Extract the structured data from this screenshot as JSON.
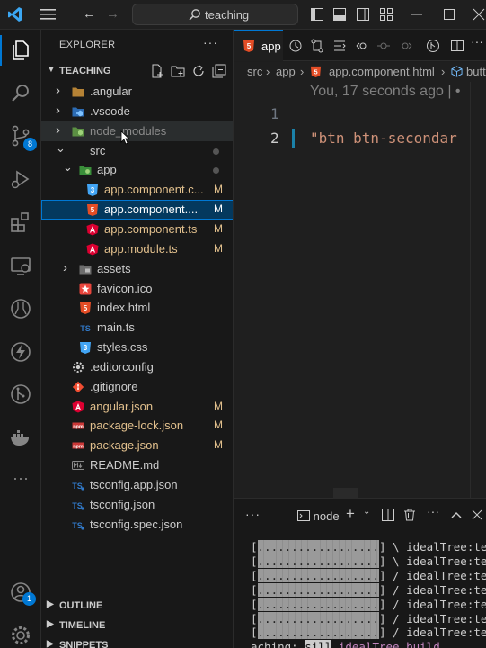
{
  "titlebar": {
    "search_text": "teaching"
  },
  "activity_bar": {
    "items": [
      {
        "name": "explorer-icon",
        "active": true
      },
      {
        "name": "search-icon"
      },
      {
        "name": "source-control-icon",
        "badge": "8"
      },
      {
        "name": "run-debug-icon"
      },
      {
        "name": "extensions-icon"
      },
      {
        "name": "remote-explorer-icon"
      },
      {
        "name": "testing-icon"
      },
      {
        "name": "lightning-icon"
      },
      {
        "name": "git-graph-icon"
      },
      {
        "name": "docker-icon"
      },
      {
        "name": "more-icon"
      }
    ],
    "accounts_badge": "1"
  },
  "explorer": {
    "title": "EXPLORER",
    "more": "···",
    "root": "TEACHING",
    "tree": [
      {
        "label": ".angular",
        "indent": 1,
        "type": "folder",
        "expanded": false,
        "icon": "folder-angular-icon"
      },
      {
        "label": ".vscode",
        "indent": 1,
        "type": "folder",
        "expanded": false,
        "icon": "folder-vscode-icon"
      },
      {
        "label": "node_modules",
        "indent": 1,
        "type": "folder",
        "expanded": false,
        "icon": "folder-node-icon",
        "dimmed": true,
        "hover": true
      },
      {
        "label": "src",
        "indent": 1,
        "type": "folder",
        "expanded": true,
        "modified_dot": true
      },
      {
        "label": "app",
        "indent": 2,
        "type": "folder",
        "expanded": true,
        "icon": "folder-app-icon",
        "modified_dot": true
      },
      {
        "label": "app.component.c...",
        "indent": 3,
        "icon": "css-file-icon",
        "status": "M"
      },
      {
        "label": "app.component....",
        "indent": 3,
        "icon": "html-file-icon",
        "status": "M",
        "selected": true
      },
      {
        "label": "app.component.ts",
        "indent": 3,
        "icon": "angular-file-icon",
        "status": "M"
      },
      {
        "label": "app.module.ts",
        "indent": 3,
        "icon": "angular-file-icon",
        "status": "M"
      },
      {
        "label": "assets",
        "indent": 2,
        "type": "folder",
        "expanded": false,
        "icon": "folder-assets-icon"
      },
      {
        "label": "favicon.ico",
        "indent": 2,
        "icon": "favicon-file-icon"
      },
      {
        "label": "index.html",
        "indent": 2,
        "icon": "html-file-icon"
      },
      {
        "label": "main.ts",
        "indent": 2,
        "icon": "ts-file-icon"
      },
      {
        "label": "styles.css",
        "indent": 2,
        "icon": "css-file-icon"
      },
      {
        "label": ".editorconfig",
        "indent": 1,
        "icon": "editorconfig-file-icon"
      },
      {
        "label": ".gitignore",
        "indent": 1,
        "icon": "git-file-icon"
      },
      {
        "label": "angular.json",
        "indent": 1,
        "icon": "angular-file-icon",
        "status": "M"
      },
      {
        "label": "package-lock.json",
        "indent": 1,
        "icon": "npm-file-icon",
        "status": "M"
      },
      {
        "label": "package.json",
        "indent": 1,
        "icon": "npm-file-icon",
        "status": "M"
      },
      {
        "label": "README.md",
        "indent": 1,
        "icon": "markdown-file-icon"
      },
      {
        "label": "tsconfig.app.json",
        "indent": 1,
        "icon": "tsconfig-file-icon"
      },
      {
        "label": "tsconfig.json",
        "indent": 1,
        "icon": "tsconfig-file-icon"
      },
      {
        "label": "tsconfig.spec.json",
        "indent": 1,
        "icon": "tsconfig-file-icon"
      }
    ],
    "sections": [
      "OUTLINE",
      "TIMELINE",
      "SNIPPETS"
    ]
  },
  "editor": {
    "tab_label": "app",
    "breadcrumb": [
      "src",
      "app",
      "app.component.html",
      "butt"
    ],
    "blame": "You, 17 seconds ago | •",
    "lines": [
      {
        "number": "1",
        "text": ""
      },
      {
        "number": "2",
        "text": "\"btn btn-secondar"
      }
    ]
  },
  "panel": {
    "more": "···",
    "terminal_name": "node",
    "output": [
      "[..................] \\ idealTree:te",
      "[..................] \\ idealTree:te",
      "[..................] / idealTree:te",
      "[..................] / idealTree:te",
      "[..................] / idealTree:te",
      "[..................] / idealTree:te",
      "[..................] / idealTree:te"
    ],
    "last_line": {
      "prefix": "aching: ",
      "sill": "sill",
      "rest": " idealTree build"
    }
  },
  "colors": {
    "accent": "#0078d4",
    "modified": "#e2c08d",
    "selection": "#04395e",
    "string": "#ce9178"
  }
}
